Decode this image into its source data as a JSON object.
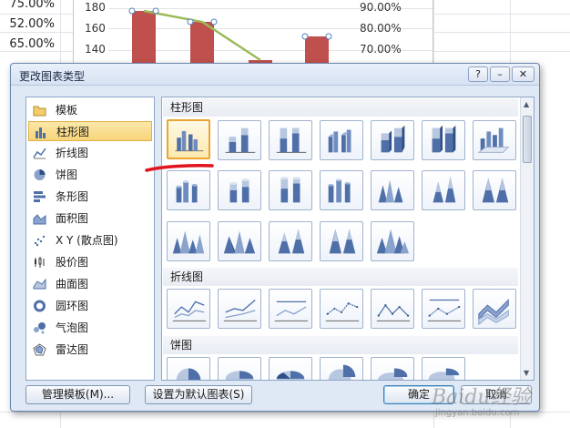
{
  "spreadsheet": {
    "left_percentages": [
      "75.00%",
      "52.00%",
      "65.00%"
    ],
    "chart_left_ticks": [
      "180",
      "160",
      "140"
    ],
    "chart_right_ticks": [
      "90.00%",
      "80.00%",
      "70.00%"
    ]
  },
  "dialog": {
    "title": "更改图表类型",
    "help_label": "?",
    "minimize_label": "–",
    "close_label": "✕",
    "categories": [
      {
        "label": "模板",
        "icon": "folder-icon",
        "selected": false
      },
      {
        "label": "柱形图",
        "icon": "column-chart-icon",
        "selected": true
      },
      {
        "label": "折线图",
        "icon": "line-chart-icon",
        "selected": false
      },
      {
        "label": "饼图",
        "icon": "pie-chart-icon",
        "selected": false
      },
      {
        "label": "条形图",
        "icon": "bar-chart-icon",
        "selected": false
      },
      {
        "label": "面积图",
        "icon": "area-chart-icon",
        "selected": false
      },
      {
        "label": "X Y (散点图)",
        "icon": "scatter-chart-icon",
        "selected": false
      },
      {
        "label": "股价图",
        "icon": "stock-chart-icon",
        "selected": false
      },
      {
        "label": "曲面图",
        "icon": "surface-chart-icon",
        "selected": false
      },
      {
        "label": "圆环图",
        "icon": "doughnut-chart-icon",
        "selected": false
      },
      {
        "label": "气泡图",
        "icon": "bubble-chart-icon",
        "selected": false
      },
      {
        "label": "雷达图",
        "icon": "radar-chart-icon",
        "selected": false
      }
    ],
    "sections": {
      "column": "柱形图",
      "line": "折线图",
      "pie": "饼图"
    },
    "buttons": {
      "manage_templates": "管理模板(M)...",
      "set_default": "设置为默认图表(S)",
      "ok": "确定",
      "cancel": "取消"
    }
  },
  "watermark": {
    "text": "Baidu经验",
    "sub": "jingyan.baidu.com"
  },
  "colors": {
    "selection_fill": "#f7d57a",
    "annotation_red": "#e0141e",
    "bar_red": "#c0504d",
    "thumb_blue": "#4f6fa8"
  }
}
